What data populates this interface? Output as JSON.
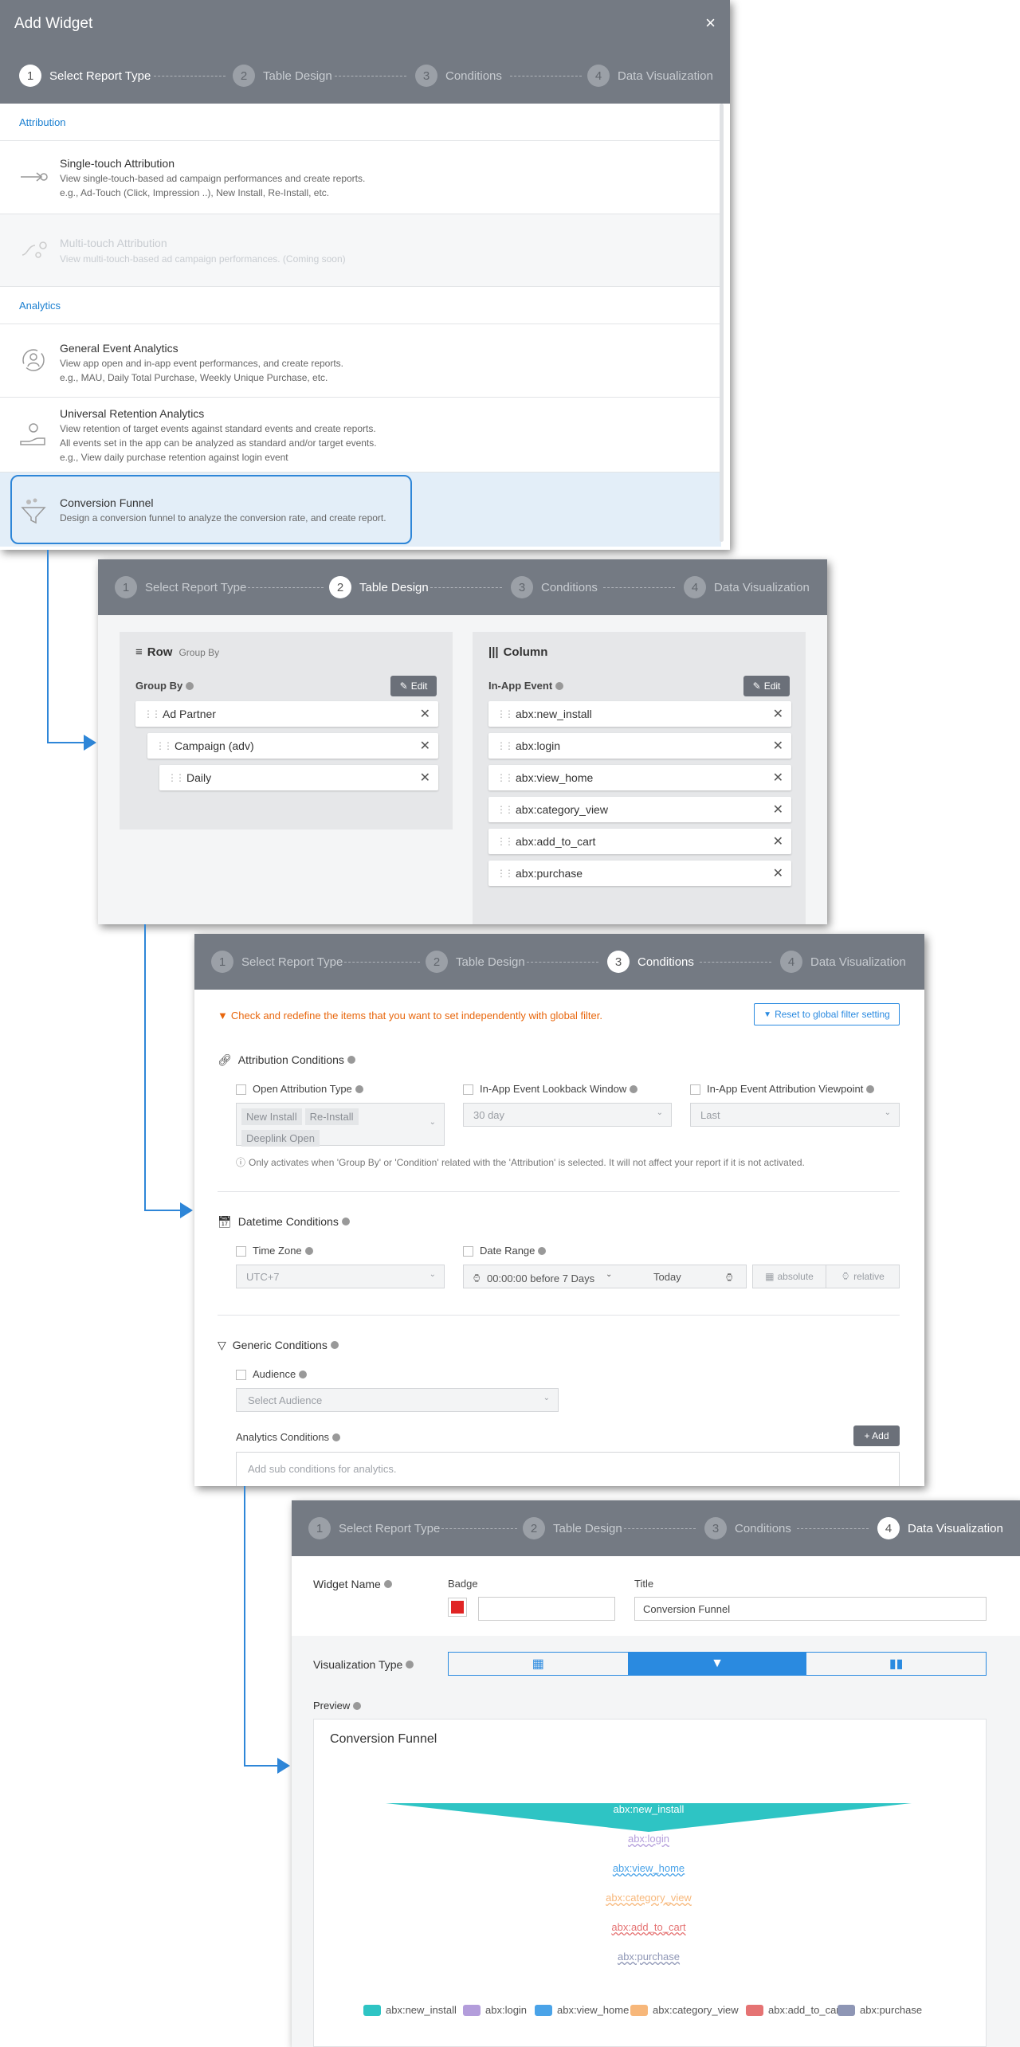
{
  "steps": [
    "Select Report Type",
    "Table Design",
    "Conditions",
    "Data Visualization"
  ],
  "step_numbers": [
    "1",
    "2",
    "3",
    "4"
  ],
  "panel1": {
    "title": "Add Widget",
    "close": "×",
    "section_attribution": "Attribution",
    "single_title": "Single-touch Attribution",
    "single_desc1": "View single-touch-based ad campaign performances and create reports.",
    "single_desc2": "e.g., Ad-Touch (Click, Impression ..), New Install, Re-Install, etc.",
    "multi_title": "Multi-touch Attribution",
    "multi_desc": "View multi-touch-based ad campaign performances. (Coming soon)",
    "section_analytics": "Analytics",
    "general_title": "General Event Analytics",
    "general_desc1": "View app open and in-app event performances, and create reports.",
    "general_desc2": "e.g., MAU, Daily Total Purchase, Weekly Unique Purchase, etc.",
    "retention_title": "Universal Retention Analytics",
    "retention_desc1": "View retention of target events against standard events and create reports.",
    "retention_desc2": "All events set in the app can be analyzed as standard and/or target events.",
    "retention_desc3": "e.g., View daily purchase retention against login event",
    "funnel_title": "Conversion Funnel",
    "funnel_desc": "Design a conversion funnel to analyze the conversion rate, and create report."
  },
  "panel2": {
    "row_title": "Row",
    "row_sub": "Group By",
    "group_by_label": "Group By",
    "edit": "Edit",
    "row_items": [
      "Ad Partner",
      "Campaign (adv)",
      "Daily"
    ],
    "col_title": "Column",
    "inapp_label": "In-App Event",
    "col_items": [
      "abx:new_install",
      "abx:login",
      "abx:view_home",
      "abx:category_view",
      "abx:add_to_cart",
      "abx:purchase"
    ]
  },
  "panel3": {
    "notice": "Check and redefine the items that you want to set independently with global filter.",
    "reset": "Reset to global filter setting",
    "attr_title": "Attribution Conditions",
    "open_attr": "Open Attribution Type",
    "tags": [
      "New Install",
      "Re-Install",
      "Deeplink Open"
    ],
    "lookback": "In-App Event Lookback Window",
    "lookback_val": "30 day",
    "viewpoint": "In-App Event Attribution Viewpoint",
    "viewpoint_val": "Last",
    "attr_note": "Only activates when 'Group By' or 'Condition' related with the 'Attribution' is selected. It will not affect your report if it is not activated.",
    "dt_title": "Datetime Conditions",
    "timezone": "Time Zone",
    "timezone_val": "UTC+7",
    "date_range": "Date Range",
    "date_from": "00:00:00 before 7 Days",
    "date_to": "Today",
    "absolute": "absolute",
    "relative": "relative",
    "generic_title": "Generic Conditions",
    "audience": "Audience",
    "audience_ph": "Select Audience",
    "analytics_cond": "Analytics Conditions",
    "add": "+ Add",
    "analytics_ph": "Add sub conditions for analytics."
  },
  "panel4": {
    "widget_name": "Widget Name",
    "badge": "Badge",
    "badge_color": "#e02424",
    "title_label": "Title",
    "title_val": "Conversion Funnel",
    "vis_type": "Visualization Type",
    "preview": "Preview",
    "chart_title": "Conversion Funnel"
  },
  "chart_data": {
    "type": "funnel",
    "title": "Conversion Funnel",
    "categories": [
      "abx:new_install",
      "abx:login",
      "abx:view_home",
      "abx:category_view",
      "abx:add_to_cart",
      "abx:purchase"
    ],
    "values": [
      1,
      0,
      0,
      0,
      0,
      0
    ],
    "colors": [
      "#2ec4c4",
      "#b39ddb",
      "#4aa3e8",
      "#f7b77a",
      "#e57373",
      "#8e96b5"
    ],
    "legend_position": "bottom"
  }
}
